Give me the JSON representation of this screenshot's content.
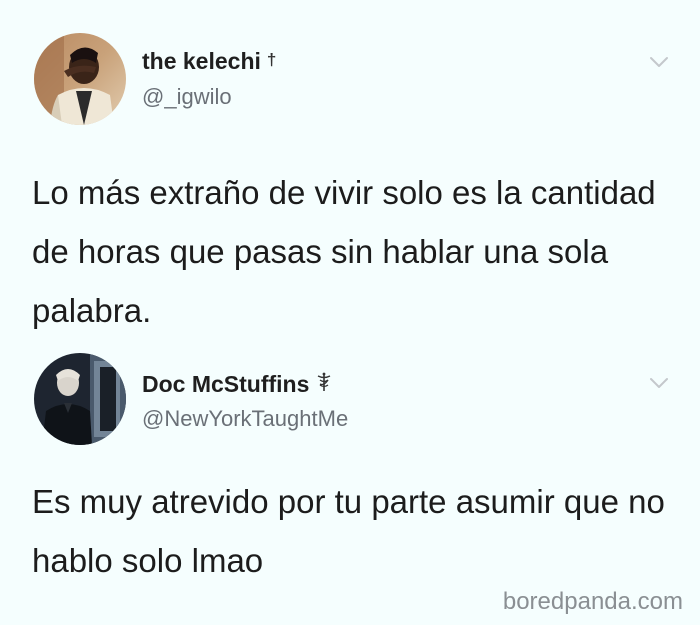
{
  "tweets": [
    {
      "display_name": "the kelechi",
      "badge": "†",
      "handle": "@_igwilo",
      "text": "Lo más extraño de vivir solo es la cantidad de horas que pasas sin hablar una sola palabra.",
      "avatar_icon": "person-photo-icon",
      "menu_icon": "chevron-down-icon"
    },
    {
      "display_name": "Doc McStuffins",
      "badge_icon": "caduceus-icon",
      "handle": "@NewYorkTaughtMe",
      "text": "Es muy atrevido por tu parte asumir que no hablo solo lmao",
      "avatar_icon": "person-photo-icon",
      "menu_icon": "chevron-down-icon"
    }
  ],
  "watermark": "boredpanda.com"
}
